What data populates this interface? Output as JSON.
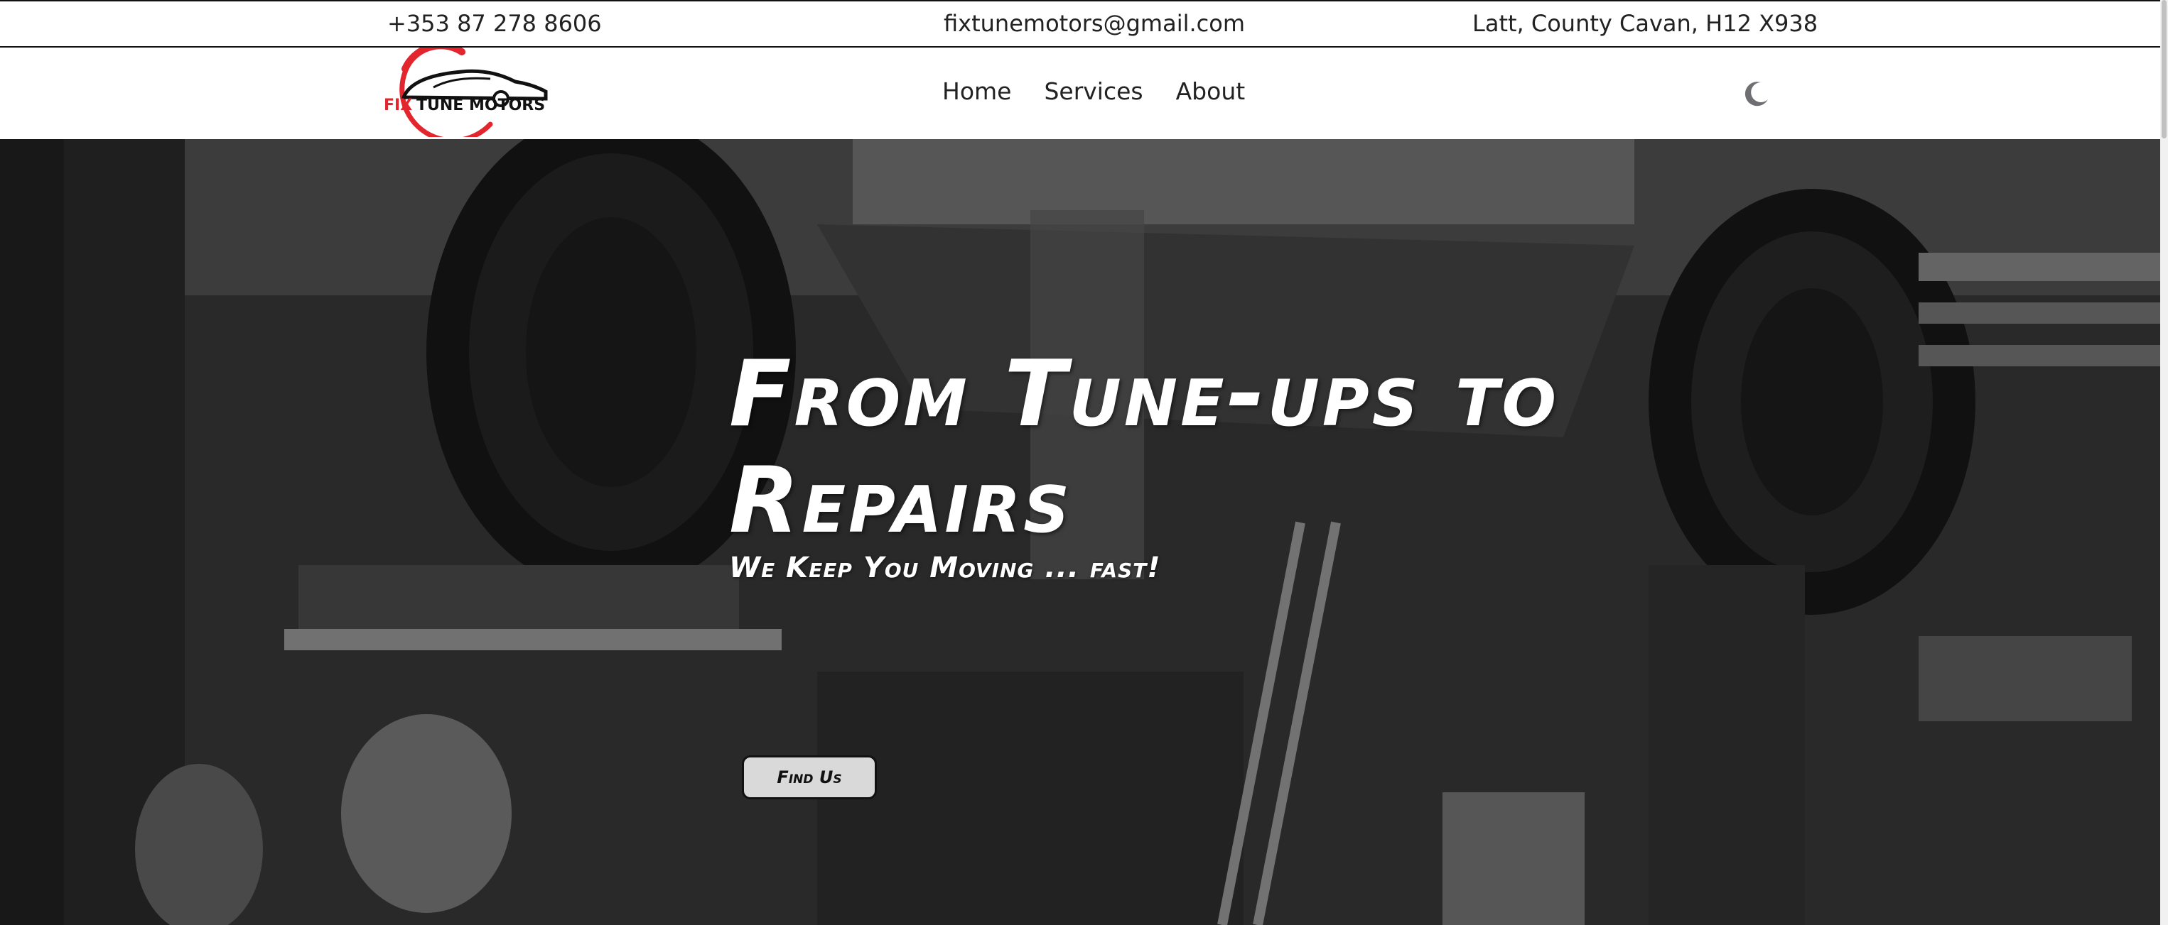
{
  "topbar": {
    "phone": "+353 87 278 8606",
    "email": "fixtunemotors@gmail.com",
    "address": "Latt, County Cavan, H12 X938"
  },
  "navbar": {
    "logo_text": {
      "fix": "FIX",
      "rest": "TUNE MOTORS"
    },
    "links": [
      {
        "label": "Home"
      },
      {
        "label": "Services"
      },
      {
        "label": "About"
      }
    ],
    "theme_toggle_icon": "moon-icon"
  },
  "hero": {
    "title": "From Tune-ups to Repairs",
    "subtitle": "We Keep You Moving ... fast!",
    "button_label": "Find Us",
    "background": "black-and-white photo of a car on a lift in a garage"
  },
  "colors": {
    "brand_red": "#e3262e",
    "text_dark": "#222222",
    "hero_text": "#ffffff",
    "button_bg": "#d9d9d9"
  }
}
